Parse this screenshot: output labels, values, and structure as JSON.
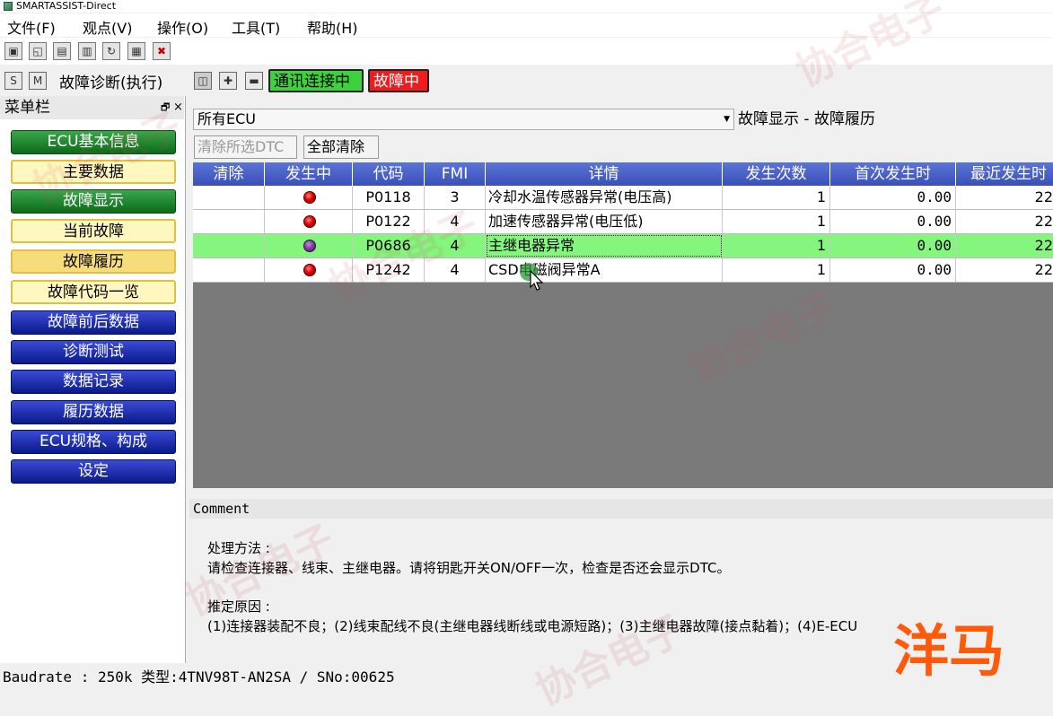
{
  "window": {
    "title": "SMARTASSIST-Direct"
  },
  "menubar": [
    "文件(F)",
    "观点(V)",
    "操作(O)",
    "工具(T)",
    "帮助(H)"
  ],
  "toolbar_icons": [
    "window-icon",
    "restore-icon",
    "save-icon",
    "copy-icon",
    "refresh-icon",
    "grid-icon",
    "delete-grid-icon"
  ],
  "diag_toolbar": {
    "title": "故障诊断(执行)",
    "comm_status": "通讯连接中",
    "fault_status": "故障中",
    "comm_color": "#3ed13e",
    "fault_color": "#ee1c1c"
  },
  "sidebar": {
    "title": "菜单栏",
    "items": [
      {
        "label": "ECU基本信息",
        "style": "green"
      },
      {
        "label": "主要数据",
        "style": "yellow"
      },
      {
        "label": "故障显示",
        "style": "green"
      },
      {
        "label": "当前故障",
        "style": "yellow"
      },
      {
        "label": "故障履历",
        "style": "yellow-selected"
      },
      {
        "label": "故障代码一览",
        "style": "yellow"
      },
      {
        "label": "故障前后数据",
        "style": "blue"
      },
      {
        "label": "诊断测试",
        "style": "blue"
      },
      {
        "label": "数据记录",
        "style": "blue"
      },
      {
        "label": "履历数据",
        "style": "blue"
      },
      {
        "label": "ECU规格、构成",
        "style": "blue"
      },
      {
        "label": "设定",
        "style": "blue"
      }
    ]
  },
  "main": {
    "ecu_select": "所有ECU",
    "breadcrumb": "故障显示 - 故障履历",
    "clear_selected_label": "清除所选DTC",
    "clear_all_label": "全部清除"
  },
  "table": {
    "headers": [
      "清除",
      "发生中",
      "代码",
      "FMI",
      "详情",
      "发生次数",
      "首次发生时",
      "最近发生时"
    ],
    "rows": [
      {
        "code": "P0118",
        "fmi": "3",
        "detail": "冷却水温传感器异常(电压高)",
        "count": "1",
        "first": "0.00",
        "last": "22",
        "indicator": "red",
        "selected": false
      },
      {
        "code": "P0122",
        "fmi": "4",
        "detail": "加速传感器异常(电压低)",
        "count": "1",
        "first": "0.00",
        "last": "22",
        "indicator": "red",
        "selected": false
      },
      {
        "code": "P0686",
        "fmi": "4",
        "detail": "主继电器异常",
        "count": "1",
        "first": "0.00",
        "last": "22",
        "indicator": "purple",
        "selected": true
      },
      {
        "code": "P1242",
        "fmi": "4",
        "detail": "CSD电磁阀异常A",
        "count": "1",
        "first": "0.00",
        "last": "22",
        "indicator": "red",
        "selected": false
      }
    ]
  },
  "comment": {
    "header": "Comment",
    "method_title": "处理方法 :",
    "method_text": "请检查连接器、线束、主继电器。请将钥匙开关ON/OFF一次，检查是否还会显示DTC。",
    "cause_title": "推定原因 :",
    "cause_text": "(1)连接器装配不良；(2)线束配线不良(主继电器线断线或电源短路)；(3)主继电器故障(接点黏着)；(4)E-ECU"
  },
  "statusbar": {
    "text": "Baudrate : 250k 类型:4TNV98T-AN2SA / SNo:00625"
  },
  "watermark": {
    "text": "协合电子",
    "corner": "洋马"
  }
}
